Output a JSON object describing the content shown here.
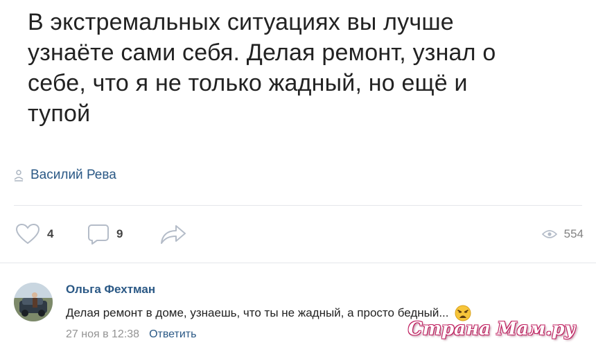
{
  "post": {
    "text_lines": [
      "В экстремальных ситуациях вы лучше",
      "узнаёте сами себя. Делая ремонт, узнал о",
      "себе, что я не только жадный, но ещё и",
      "тупой"
    ],
    "author": "Василий Рева",
    "author_icon": "user-icon"
  },
  "actions": {
    "likes": "4",
    "comments": "9",
    "views": "554"
  },
  "comment": {
    "author": "Ольга Фехтман",
    "text": "Делая ремонт в доме, узнаешь, что ты не жадный, а просто бедный...",
    "emoji": "weary-face-emoji",
    "date": "27 ноя в 12:38",
    "reply_label": "Ответить"
  },
  "watermark": "Страна Мам.ру",
  "colors": {
    "link": "#2a5885",
    "text": "#222222",
    "muted": "#939393",
    "icon": "#b4bcc8",
    "divider": "#e4e6ea",
    "watermark": "#c02060"
  }
}
